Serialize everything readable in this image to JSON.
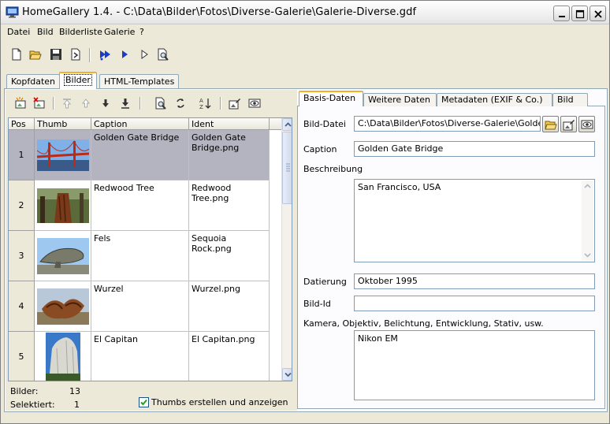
{
  "window": {
    "title": "HomeGallery 1.4. - C:\\Data\\Bilder\\Fotos\\Diverse-Galerie\\Galerie-Diverse.gdf"
  },
  "menu": {
    "items": [
      {
        "label": "Datei"
      },
      {
        "label": "Bild"
      },
      {
        "label": "Bilderliste"
      },
      {
        "label": "Galerie"
      },
      {
        "label": "?"
      }
    ]
  },
  "toolbar": {
    "icons": [
      "new-file-icon",
      "open-folder-icon",
      "save-icon",
      "export-icon",
      "run-all-icon",
      "play-icon",
      "play-outline-icon",
      "preview-icon"
    ]
  },
  "tabs": [
    {
      "label": "Kopfdaten"
    },
    {
      "label": "Bilder",
      "active": true
    },
    {
      "label": "HTML-Templates"
    }
  ],
  "image_list": {
    "columns": [
      "Pos",
      "Thumb",
      "Caption",
      "Ident"
    ],
    "rows": [
      {
        "pos": "1",
        "caption": "Golden Gate Bridge",
        "ident": "Golden Gate Bridge.png",
        "thumb": "bridge",
        "selected": true
      },
      {
        "pos": "2",
        "caption": "Redwood Tree",
        "ident": "Redwood Tree.png",
        "thumb": "redwood"
      },
      {
        "pos": "3",
        "caption": "Fels",
        "ident": "Sequoia Rock.png",
        "thumb": "rock"
      },
      {
        "pos": "4",
        "caption": "Wurzel",
        "ident": "Wurzel.png",
        "thumb": "root"
      },
      {
        "pos": "5",
        "caption": "El Capitan",
        "ident": "El Capitan.png",
        "thumb": "capitan"
      }
    ]
  },
  "status": {
    "bilder_label": "Bilder:",
    "bilder_count": "13",
    "selektiert_label": "Selektiert:",
    "selektiert_count": "1",
    "thumbs_checkbox_label": "Thumbs erstellen und anzeigen",
    "thumbs_checked": true
  },
  "detail_tabs": [
    {
      "label": "Basis-Daten",
      "active": true
    },
    {
      "label": "Weitere Daten"
    },
    {
      "label": "Metadaten (EXIF & Co.)"
    },
    {
      "label": "Bild"
    }
  ],
  "detail": {
    "bild_datei_label": "Bild-Datei",
    "bild_datei_value": "C:\\Data\\Bilder\\Fotos\\Diverse-Galerie\\Golden Gate Bridge.png",
    "caption_label": "Caption",
    "caption_value": "Golden Gate Bridge",
    "beschreibung_label": "Beschreibung",
    "beschreibung_value": "San Francisco, USA",
    "datierung_label": "Datierung",
    "datierung_value": "Oktober 1995",
    "bild_id_label": "Bild-Id",
    "bild_id_value": "",
    "kamera_label": "Kamera, Objektiv, Belichtung, Entwicklung, Stativ, usw.",
    "kamera_value": "Nikon EM"
  }
}
